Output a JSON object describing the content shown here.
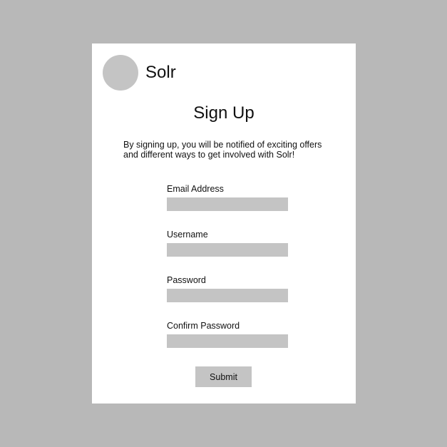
{
  "header": {
    "brand_name": "Solr",
    "logo_icon": "circle-logo-icon"
  },
  "form": {
    "title": "Sign Up",
    "intro": "By signing up, you will be notified of exciting offers and different ways to get involved with Solr!",
    "fields": [
      {
        "label": "Email Address",
        "value": ""
      },
      {
        "label": "Username",
        "value": ""
      },
      {
        "label": "Password",
        "value": ""
      },
      {
        "label": "Confirm Password",
        "value": ""
      }
    ],
    "submit_label": "Submit"
  },
  "colors": {
    "background": "#b8b8b8",
    "card": "#ffffff",
    "placeholder_gray": "#c4c4c4"
  }
}
